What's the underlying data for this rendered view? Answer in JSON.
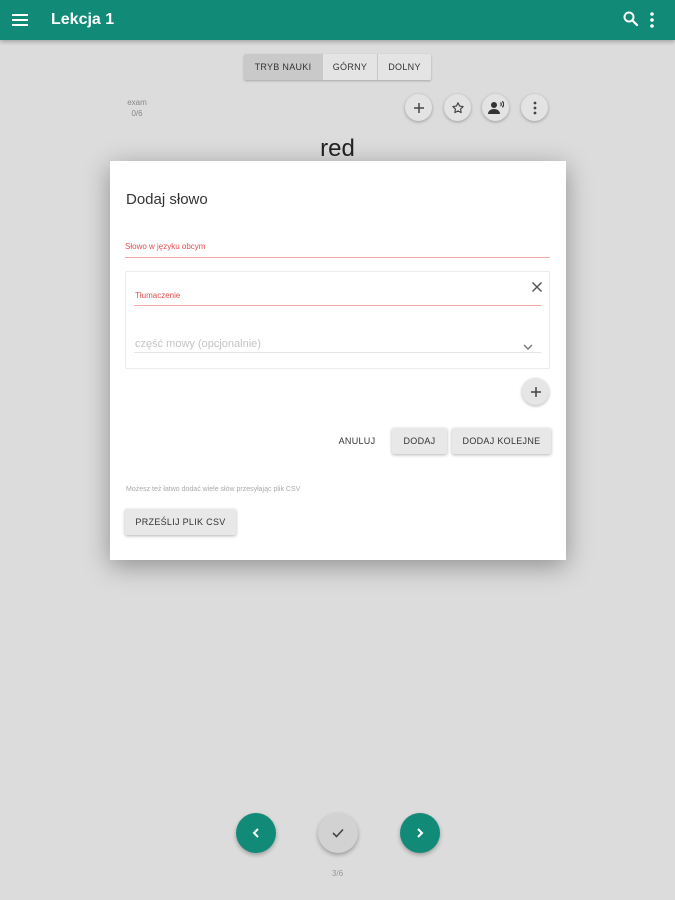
{
  "appbar": {
    "title": "Lekcja 1",
    "menu_icon": "menu-icon",
    "search_icon": "search-icon",
    "more_icon": "more-vert-icon",
    "color": "#128a78"
  },
  "modes": {
    "items": [
      {
        "label": "TRYB NAUKI",
        "active": true
      },
      {
        "label": "GÓRNY",
        "active": false
      },
      {
        "label": "DOLNY",
        "active": false
      }
    ]
  },
  "exam": {
    "label": "exam",
    "count": "0/6"
  },
  "toolbar_icons": [
    "add-icon",
    "star-outline-icon",
    "person-voice-icon",
    "more-vert-icon"
  ],
  "current_word": "red",
  "dialog": {
    "title": "Dodaj słowo",
    "foreign_word_label": "Słowo w języku obcym",
    "translation_label": "Tłumaczenie",
    "part_of_speech_placeholder": "część mowy (opcjonalnie)",
    "cancel_label": "ANULUJ",
    "add_label": "DODAJ",
    "add_next_label": "DODAJ KOLEJNE",
    "hint": "Możesz też łatwo dodać wiele słów przesyłając plik CSV",
    "upload_label": "PRZEŚLIJ PLIK CSV"
  },
  "bottom_nav": {
    "prev_icon": "chevron-left-icon",
    "check_icon": "check-icon",
    "next_icon": "chevron-right-icon",
    "counter": "3/6"
  }
}
